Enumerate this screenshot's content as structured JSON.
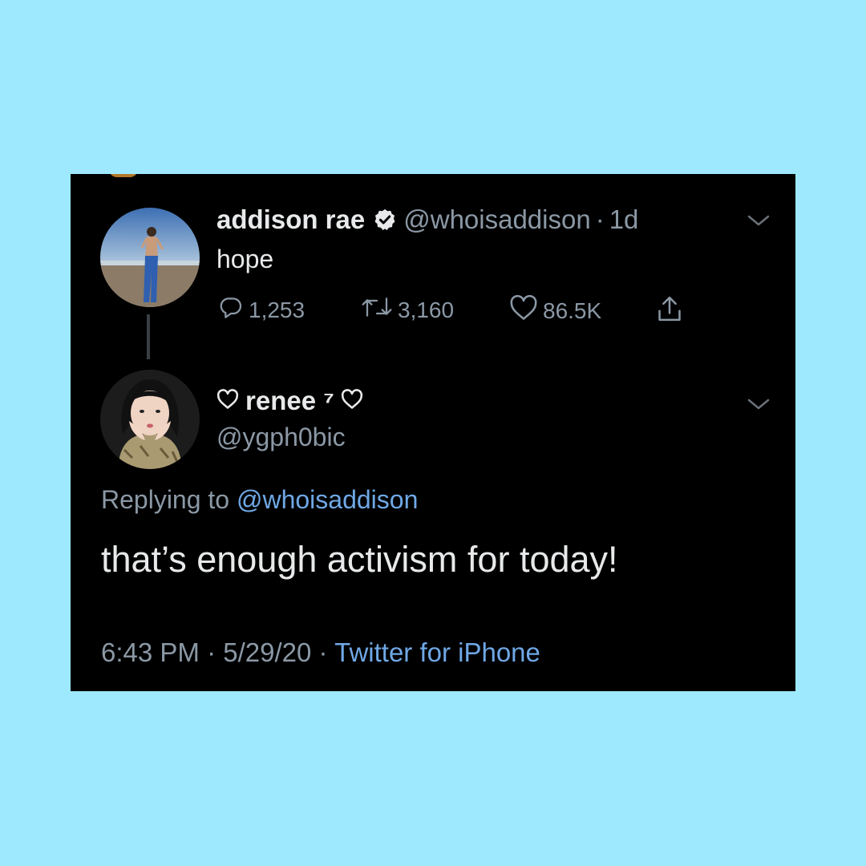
{
  "tweet": {
    "display_name": "addison rae",
    "handle": "@whoisaddison",
    "separator": "·",
    "age": "1d",
    "text": "hope",
    "replies": "1,253",
    "retweets": "3,160",
    "likes": "86.5K",
    "icons": [
      "verified-badge-icon",
      "chevron-down-icon",
      "reply-icon",
      "retweet-icon",
      "heart-icon",
      "share-icon"
    ]
  },
  "reply": {
    "display_name": "renee ⁷",
    "handle": "@ygph0bic",
    "replying_prefix": "Replying to",
    "replying_mention": "@whoisaddison",
    "text": "that’s enough activism for today!",
    "time": "6:43 PM",
    "date": "5/29/20",
    "separator": "·",
    "source": "Twitter for iPhone"
  },
  "colors": {
    "background": "#9ee9fd",
    "card": "#000000",
    "primary_text": "#e7e9ea",
    "secondary_text": "#8b98a5",
    "link": "#6fa8e6"
  }
}
